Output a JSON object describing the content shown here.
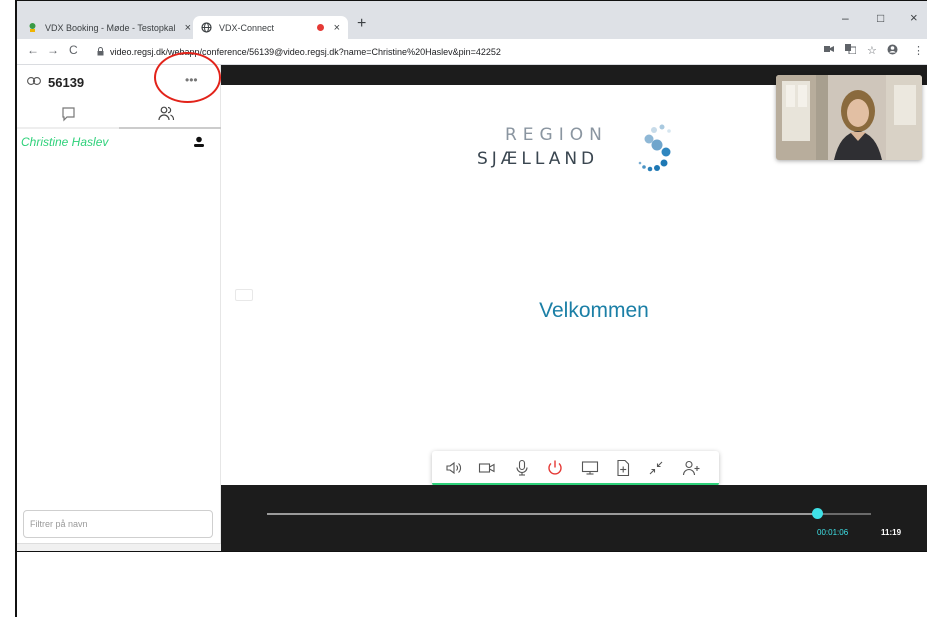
{
  "browser": {
    "tabs": [
      {
        "title": "VDX Booking - Møde - Testopkal",
        "favicon": "vdx-leaf-icon",
        "active": false
      },
      {
        "title": "VDX-Connect",
        "favicon": "globe-icon",
        "active": true,
        "recording": true
      }
    ],
    "new_tab_label": "+",
    "window_controls": {
      "minimize": "–",
      "maximize": "□",
      "close": "×"
    },
    "url": "video.regsj.dk/webapp/conference/56139@video.regsj.dk?name=Christine%20Haslev&pin=42252"
  },
  "sidebar": {
    "room_number": "56139",
    "more_label": "•••",
    "participants": [
      {
        "name": "Christine Haslev"
      }
    ],
    "filter_placeholder": "Filtrer på navn"
  },
  "main": {
    "logo": {
      "line1": "REGION",
      "line2": "SJÆLLAND"
    },
    "welcome_text": "Velkommen",
    "controls": [
      "speaker-icon",
      "camera-icon",
      "microphone-icon",
      "power-icon",
      "screen-share-icon",
      "add-file-icon",
      "minimize-icon",
      "add-person-icon"
    ],
    "timeline": {
      "progress": 0.91,
      "elapsed": "00:01:06",
      "clock": "11:19"
    }
  },
  "colors": {
    "accent_green": "#2ed17a",
    "accent_teal": "#3fe0e6",
    "welcome_blue": "#1b7fa6",
    "hangup_red": "#e53935",
    "annotation_red": "#e2231a"
  }
}
